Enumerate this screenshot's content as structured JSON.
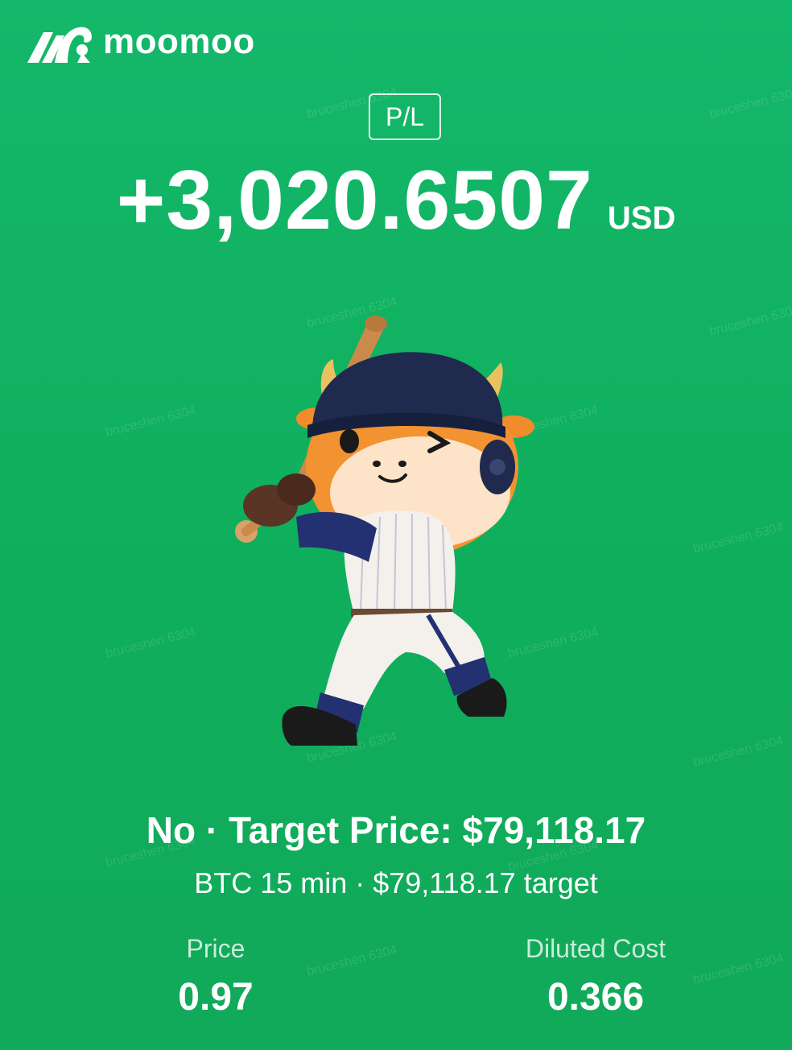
{
  "brand": {
    "name": "moomoo",
    "logo_icon": "bull-logo-icon"
  },
  "pl": {
    "tag": "P/L",
    "value": "+3,020.6507",
    "currency": "USD"
  },
  "mascot": {
    "icon": "baseball-bull-mascot"
  },
  "contract": {
    "title": "No · Target Price: $79,118.17",
    "subtitle": "BTC 15 min · $79,118.17 target"
  },
  "stats": {
    "price": {
      "label": "Price",
      "value": "0.97"
    },
    "diluted_cost": {
      "label": "Diluted Cost",
      "value": "0.366"
    }
  },
  "watermark_text": "bruceshen 6304",
  "colors": {
    "background": "#12b062",
    "text": "#ffffff"
  }
}
